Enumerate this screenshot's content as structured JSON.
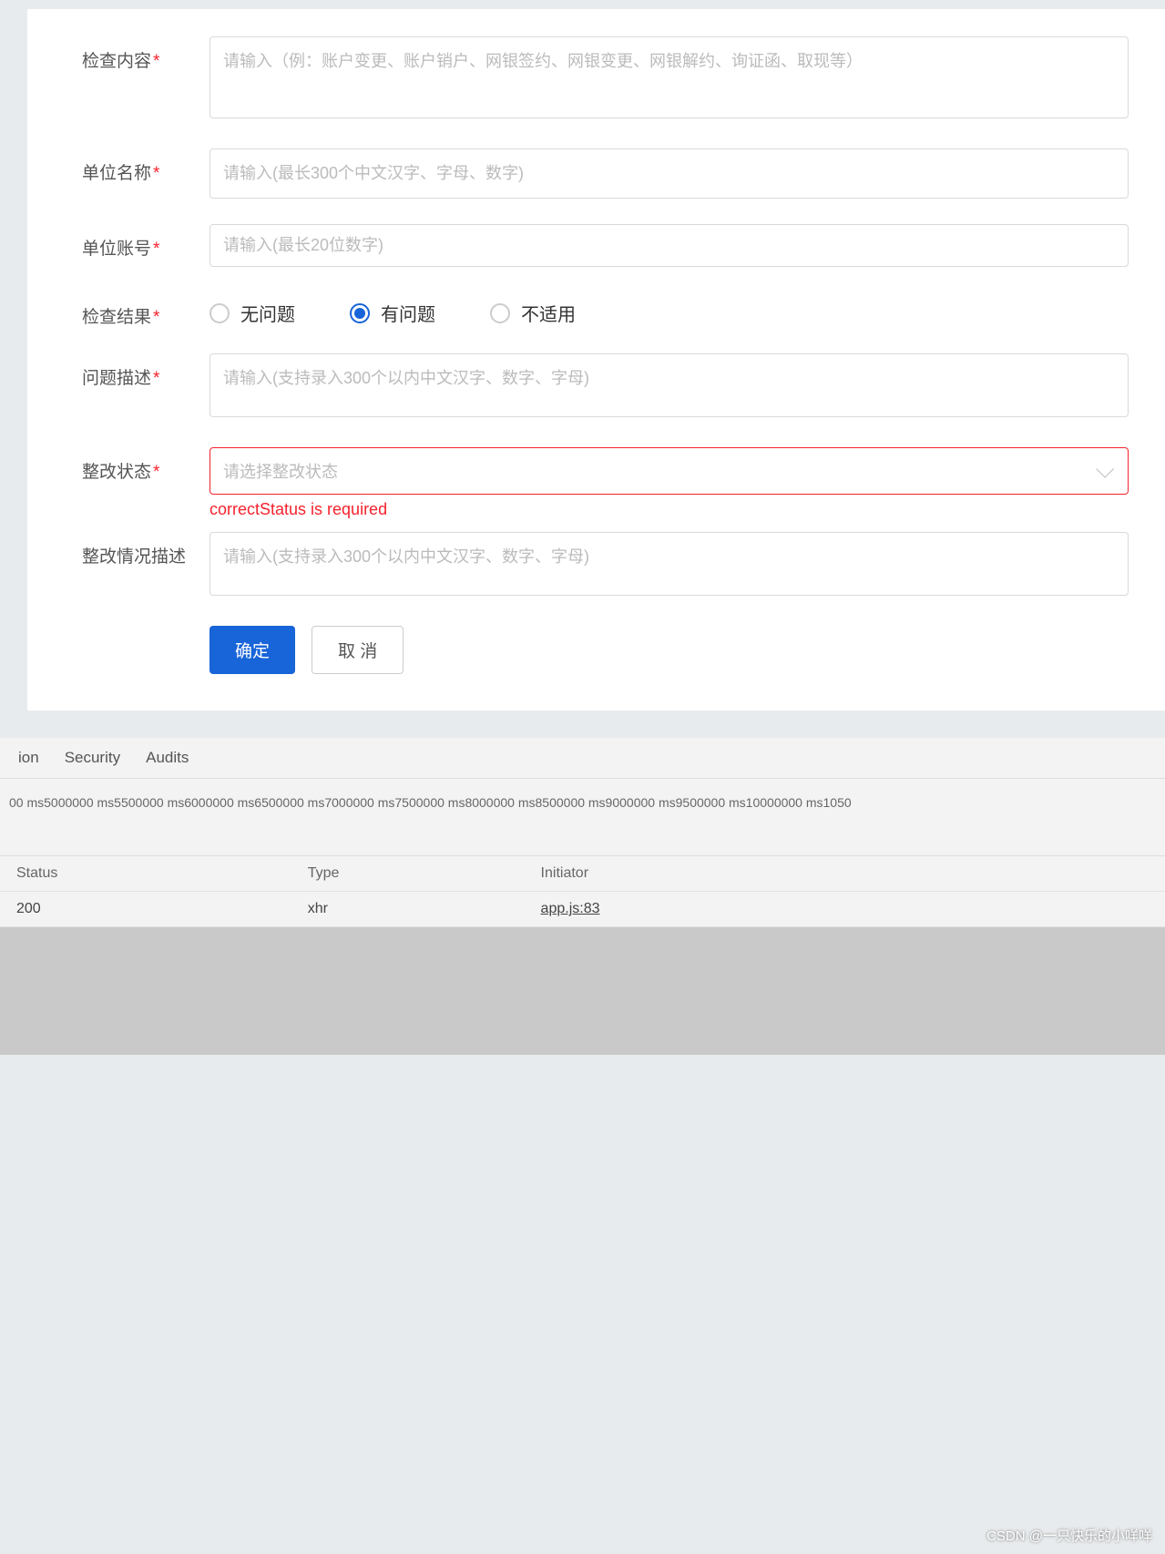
{
  "form": {
    "inspect_content": {
      "label": "检查内容",
      "placeholder": "请输入（例：账户变更、账户销户、网银签约、网银变更、网银解约、询证函、取现等）"
    },
    "unit_name": {
      "label": "单位名称",
      "placeholder": "请输入(最长300个中文汉字、字母、数字)"
    },
    "unit_account": {
      "label": "单位账号",
      "placeholder": "请输入(最长20位数字)"
    },
    "inspect_result": {
      "label": "检查结果",
      "options": [
        "无问题",
        "有问题",
        "不适用"
      ],
      "selected_index": 1
    },
    "issue_desc": {
      "label": "问题描述",
      "placeholder": "请输入(支持录入300个以内中文汉字、数字、字母)"
    },
    "correct_status": {
      "label": "整改状态",
      "placeholder": "请选择整改状态",
      "error": "correctStatus is required"
    },
    "correct_desc": {
      "label": "整改情况描述",
      "placeholder": "请输入(支持录入300个以内中文汉字、数字、字母)"
    },
    "buttons": {
      "confirm": "确定",
      "cancel": "取 消"
    }
  },
  "devtools": {
    "tabs": [
      "ion",
      "Security",
      "Audits"
    ],
    "timeline_ticks": "00 ms5000000 ms5500000 ms6000000 ms6500000 ms7000000 ms7500000 ms8000000 ms8500000 ms9000000 ms9500000 ms10000000 ms1050",
    "columns": {
      "status": "Status",
      "type": "Type",
      "initiator": "Initiator"
    },
    "row": {
      "status": "200",
      "type": "xhr",
      "initiator": "app.js:83"
    }
  },
  "watermark": "CSDN @一只快乐的小咩咩"
}
